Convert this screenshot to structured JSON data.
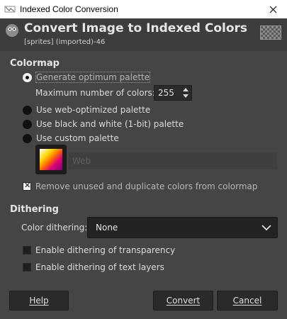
{
  "window": {
    "title": "Indexed Color Conversion"
  },
  "header": {
    "title": "Convert Image to Indexed Colors",
    "subtitle": "[sprites] (imported)-46"
  },
  "colormap": {
    "section_label": "Colormap",
    "options": [
      {
        "label": "Generate optimum palette",
        "selected": true
      },
      {
        "label": "Use web-optimized palette",
        "selected": false
      },
      {
        "label": "Use black and white (1-bit) palette",
        "selected": false
      },
      {
        "label": "Use custom palette",
        "selected": false
      }
    ],
    "max_colors_label": "Maximum number of colors:",
    "max_colors_value": "255",
    "custom_palette_name": "Web",
    "remove_unused_label": "Remove unused and duplicate colors from colormap",
    "remove_unused_checked": true
  },
  "dithering": {
    "section_label": "Dithering",
    "color_dithering_label": "Color dithering:",
    "color_dithering_value": "None",
    "transparency_label": "Enable dithering of transparency",
    "transparency_checked": false,
    "text_layers_label": "Enable dithering of text layers",
    "text_layers_checked": false
  },
  "buttons": {
    "help": "Help",
    "convert": "Convert",
    "cancel": "Cancel"
  },
  "icons": {
    "close": "close-icon",
    "app": "app-icon",
    "wilber": "gimp-wilber-icon"
  }
}
